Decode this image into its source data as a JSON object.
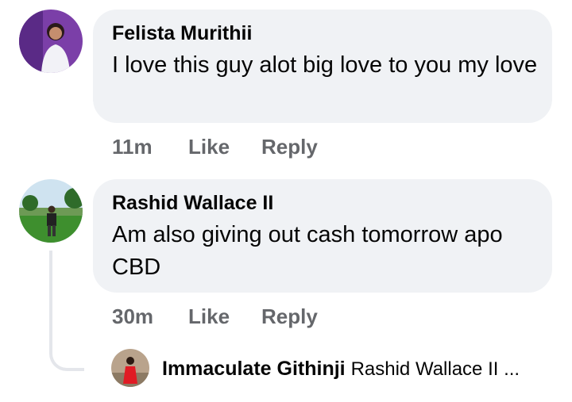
{
  "comments": [
    {
      "author": "Felista Murithii",
      "text": "I love this guy alot big love to you my love",
      "time": "11m",
      "like_label": "Like",
      "reply_label": "Reply"
    },
    {
      "author": "Rashid Wallace II",
      "text": "Am also giving out cash tomorrow apo CBD",
      "time": "30m",
      "like_label": "Like",
      "reply_label": "Reply"
    }
  ],
  "reply_preview": {
    "author": "Immaculate Githinji",
    "snippet": "Rashid Wallace II ..."
  },
  "colors": {
    "bubble": "#f0f2f5",
    "meta_text": "#65676b",
    "thread_line": "#e4e6eb"
  }
}
